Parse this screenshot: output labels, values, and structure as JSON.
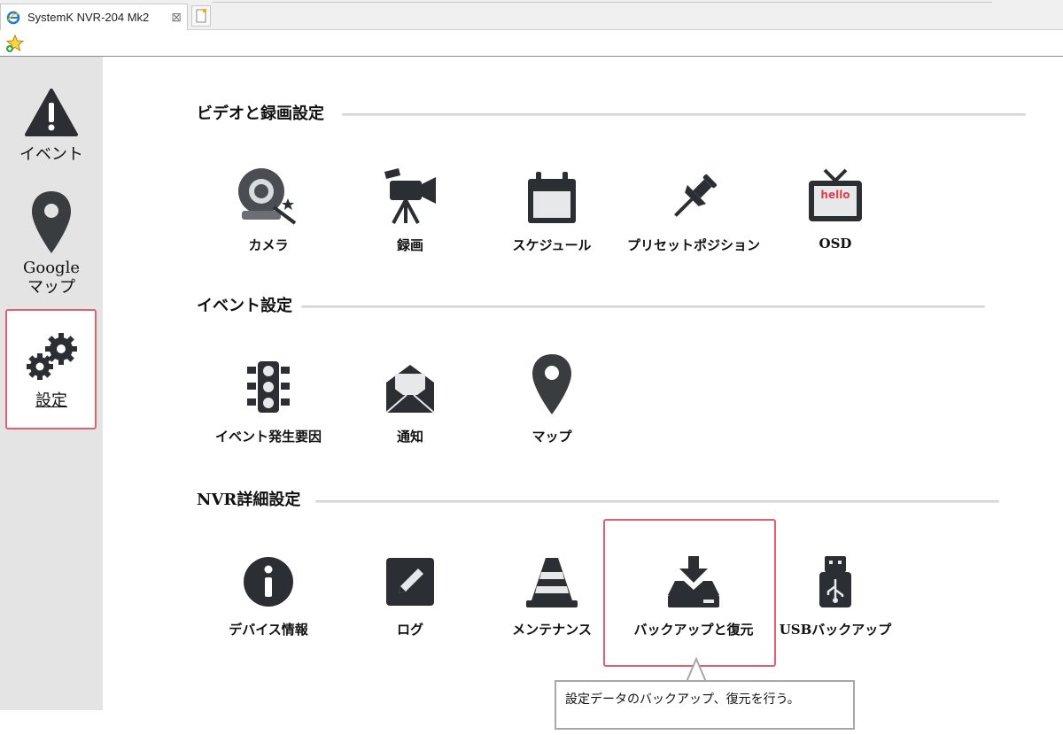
{
  "browser": {
    "tab_title": "SystemK NVR-204 Mk2",
    "tab_close": "⊠"
  },
  "sidebar": {
    "items": [
      {
        "label": "イベント",
        "icon": "warning-icon"
      },
      {
        "label_line1": "Google",
        "label_line2": "マップ",
        "icon": "map-pin-icon"
      },
      {
        "label": "設定",
        "icon": "gears-icon",
        "selected": true
      }
    ]
  },
  "sections": [
    {
      "title": "ビデオと録画設定",
      "items": [
        {
          "label": "カメラ",
          "icon": "camera-icon"
        },
        {
          "label": "録画",
          "icon": "video-camera-icon"
        },
        {
          "label": "スケジュール",
          "icon": "calendar-icon"
        },
        {
          "label": "プリセットポジション",
          "icon": "pushpin-icon"
        },
        {
          "label": "OSD",
          "icon": "tv-icon"
        }
      ]
    },
    {
      "title": "イベント設定",
      "items": [
        {
          "label": "イベント発生要因",
          "icon": "traffic-light-icon"
        },
        {
          "label": "通知",
          "icon": "envelope-icon"
        },
        {
          "label": "マップ",
          "icon": "map-pin-icon"
        }
      ]
    },
    {
      "title": "NVR詳細設定",
      "items": [
        {
          "label": "デバイス情報",
          "icon": "info-icon"
        },
        {
          "label": "ログ",
          "icon": "log-edit-icon"
        },
        {
          "label": "メンテナンス",
          "icon": "traffic-cone-icon"
        },
        {
          "label": "バックアップと復元",
          "icon": "backup-download-icon"
        },
        {
          "label": "USBバックアップ",
          "icon": "usb-icon"
        }
      ]
    }
  ],
  "osd_icon_text": "hello",
  "callout_text": "設定データのバックアップ、復元を行う。",
  "colors": {
    "highlight": "#e06070",
    "sidebar_bg": "#e4e4e4",
    "icon": "#2b2f33"
  }
}
